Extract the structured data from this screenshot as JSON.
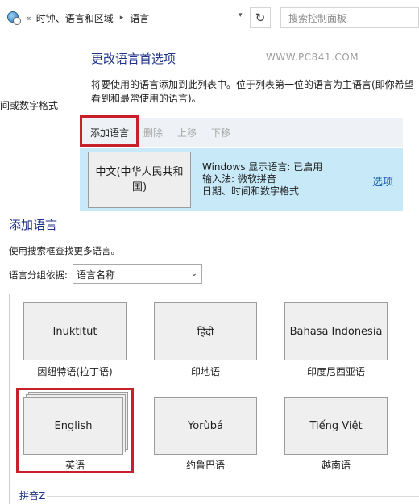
{
  "address_bar": {
    "back_sep": "«",
    "crumbs": [
      "时钟、语言和区域",
      "语言"
    ],
    "crumb_arrow": "▸",
    "refresh_icon": "↻",
    "search_placeholder": "搜索控制面板"
  },
  "left_nav": {
    "item": "间或数字格式"
  },
  "header": {
    "title": "更改语言首选项",
    "watermark": "WWW.PC841.COM",
    "description": "将要使用的语言添加到此列表中。位于列表第一位的语言为主语言(即你希望看到和最常使用的语言)。"
  },
  "toolbar": {
    "add": "添加语言",
    "delete": "删除",
    "move_up": "上移",
    "move_down": "下移"
  },
  "current_language": {
    "tile": "中文(中华人民共和国)",
    "info": [
      "Windows 显示语言: 已启用",
      "输入法: 微软拼音",
      "日期、时间和数字格式"
    ],
    "options": "选项"
  },
  "add_language": {
    "title": "添加语言",
    "description": "使用搜索框查找更多语言。",
    "group_label": "语言分组依据:",
    "group_value": "语言名称",
    "tiles": [
      {
        "native": "Inuktitut",
        "label": "因纽特语(拉丁语)"
      },
      {
        "native": "हिंदी",
        "label": "印地语"
      },
      {
        "native": "Bahasa Indonesia",
        "label": "印度尼西亚语"
      },
      {
        "native": "English",
        "label": "英语"
      },
      {
        "native": "Yorùbá",
        "label": "约鲁巴语"
      },
      {
        "native": "Tiếng Việt",
        "label": "越南语"
      }
    ],
    "next_section": "拼音Z"
  },
  "colors": {
    "accent_heading": "#1e3287",
    "highlight_box": "#c8202b",
    "selected_row": "#c7e9f8",
    "link": "#1a5fb4"
  }
}
